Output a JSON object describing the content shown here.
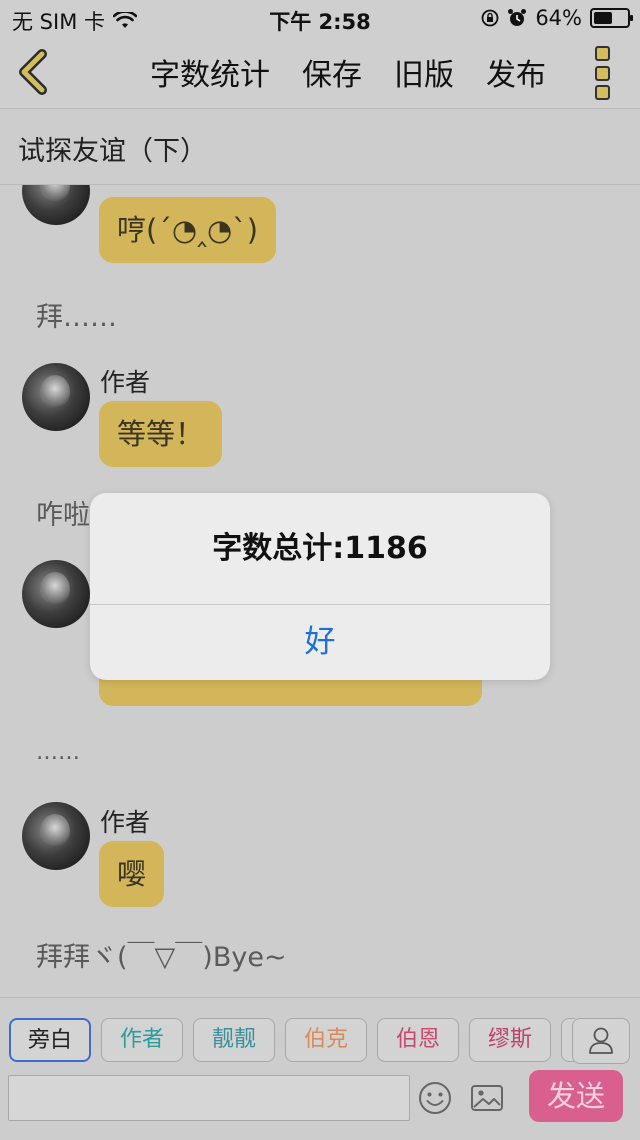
{
  "status_bar": {
    "carrier": "无 SIM 卡",
    "time": "下午 2:58",
    "battery_percent": "64%",
    "battery_level": 0.64
  },
  "navbar": {
    "back_icon": "chevron-left-icon",
    "items": [
      "字数统计",
      "保存",
      "旧版",
      "发布"
    ],
    "more_icon": "more-vertical-icon"
  },
  "story_title": "试探友谊（下）",
  "chat": {
    "messages": [
      {
        "text": "哼(´◔‸◔`)"
      },
      {
        "narration": "拜……"
      },
      {
        "speaker": "作者",
        "text": "等等！"
      },
      {
        "narration": "咋啦"
      },
      {
        "narration": "……"
      },
      {
        "speaker": "作者",
        "text": "嘤"
      },
      {
        "narration": "拜拜ヾ(￣▽￣)Bye~"
      }
    ]
  },
  "alert": {
    "message": "字数总计:1186",
    "ok_label": "好"
  },
  "roles": [
    {
      "label": "旁白",
      "color": "#222222",
      "active": true
    },
    {
      "label": "作者",
      "color": "#2a9d9a"
    },
    {
      "label": "靓靓",
      "color": "#3a8f9a"
    },
    {
      "label": "伯克",
      "color": "#d98a5a"
    },
    {
      "label": "伯恩",
      "color": "#c74a6e"
    },
    {
      "label": "缪斯",
      "color": "#c0406a"
    }
  ],
  "composer": {
    "input_value": "",
    "send_label": "发送"
  },
  "colors": {
    "bubble": "#d3b65a",
    "send": "#d9608e",
    "alert_button": "#1e6fd9"
  }
}
